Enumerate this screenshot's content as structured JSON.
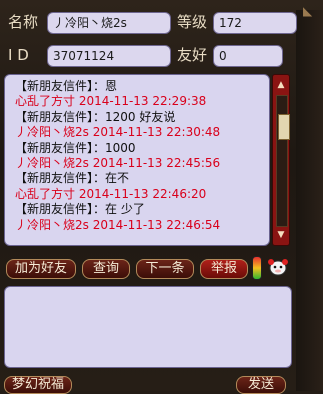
{
  "profile": {
    "name_label": "名称",
    "name_value": "丿冷阳丶烧2s",
    "level_label": "等级",
    "level_value": "172",
    "id_label": "I D",
    "id_value": "37071124",
    "friendship_label": "友好",
    "friendship_value": "0"
  },
  "messages": [
    {
      "kind": "sys",
      "text": "【新朋友信件】：恩"
    },
    {
      "kind": "red",
      "text": "心乱了方寸 2014-11-13 22:29:38"
    },
    {
      "kind": "sys",
      "text": "【新朋友信件】：1200 好友说"
    },
    {
      "kind": "red",
      "text": "丿冷阳丶烧2s 2014-11-13 22:30:48"
    },
    {
      "kind": "sys",
      "text": "【新朋友信件】：1000"
    },
    {
      "kind": "red",
      "text": "丿冷阳丶烧2s 2014-11-13 22:45:56"
    },
    {
      "kind": "sys",
      "text": "【新朋友信件】：在不"
    },
    {
      "kind": "red",
      "text": "心乱了方寸 2014-11-13 22:46:20"
    },
    {
      "kind": "sys",
      "text": "【新朋友信件】：在 少了"
    },
    {
      "kind": "red",
      "text": "丿冷阳丶烧2s 2014-11-13 22:46:54"
    }
  ],
  "buttons": {
    "add_friend": "加为好友",
    "lookup": "查询",
    "next": "下一条",
    "report": "举报",
    "bottom_left": "梦幻祝福",
    "send": "发送"
  },
  "colors": {
    "timestamp_red": "#d9001b",
    "panel_bg": "#d9d5ef"
  }
}
